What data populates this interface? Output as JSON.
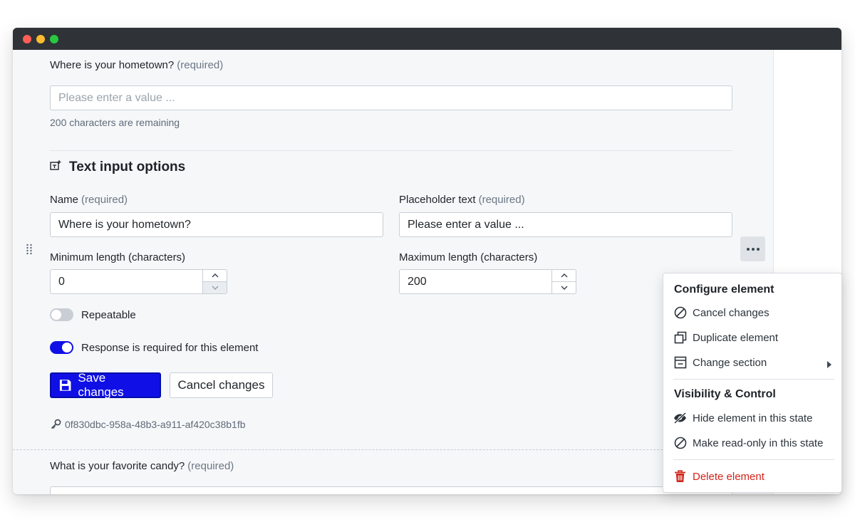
{
  "window": {
    "controls": [
      "close",
      "minimize",
      "maximize"
    ]
  },
  "form": {
    "preview": {
      "question": "Where is your hometown?",
      "required_tag": "(required)",
      "placeholder": "Please enter a value ...",
      "helper": "200 characters are remaining"
    },
    "options": {
      "title": "Text input options",
      "icon": "text-input-icon",
      "name_label": "Name",
      "name_required": "(required)",
      "name_value": "Where is your hometown?",
      "placeholder_label": "Placeholder text",
      "placeholder_required": "(required)",
      "placeholder_value": "Please enter a value ...",
      "min_label": "Minimum length (characters)",
      "min_value": "0",
      "max_label": "Maximum length (characters)",
      "max_value": "200",
      "repeatable_label": "Repeatable",
      "repeatable_on": false,
      "required_label": "Response is required for this element",
      "required_on": true,
      "save_label": "Save changes",
      "cancel_label": "Cancel changes",
      "element_id": "0f830dbc-958a-48b3-a911-af420c38b1fb"
    },
    "next": {
      "question": "What is your favorite candy?",
      "required_tag": "(required)"
    }
  },
  "menu": {
    "heading_configure": "Configure element",
    "items_configure": [
      {
        "label": "Cancel changes",
        "icon": "cancel-circle-icon"
      },
      {
        "label": "Duplicate element",
        "icon": "duplicate-icon"
      },
      {
        "label": "Change section",
        "icon": "section-icon",
        "submenu": true
      }
    ],
    "heading_visibility": "Visibility & Control",
    "items_visibility": [
      {
        "label": "Hide element in this state",
        "icon": "eye-slash-icon"
      },
      {
        "label": "Make read-only in this state",
        "icon": "cancel-circle-icon"
      }
    ],
    "delete_label": "Delete element",
    "delete_icon": "trash-icon"
  },
  "colors": {
    "primary": "#1010e6",
    "danger": "#d0241b",
    "toggle_on": "#1010e6",
    "toggle_off": "#c9ced4"
  }
}
